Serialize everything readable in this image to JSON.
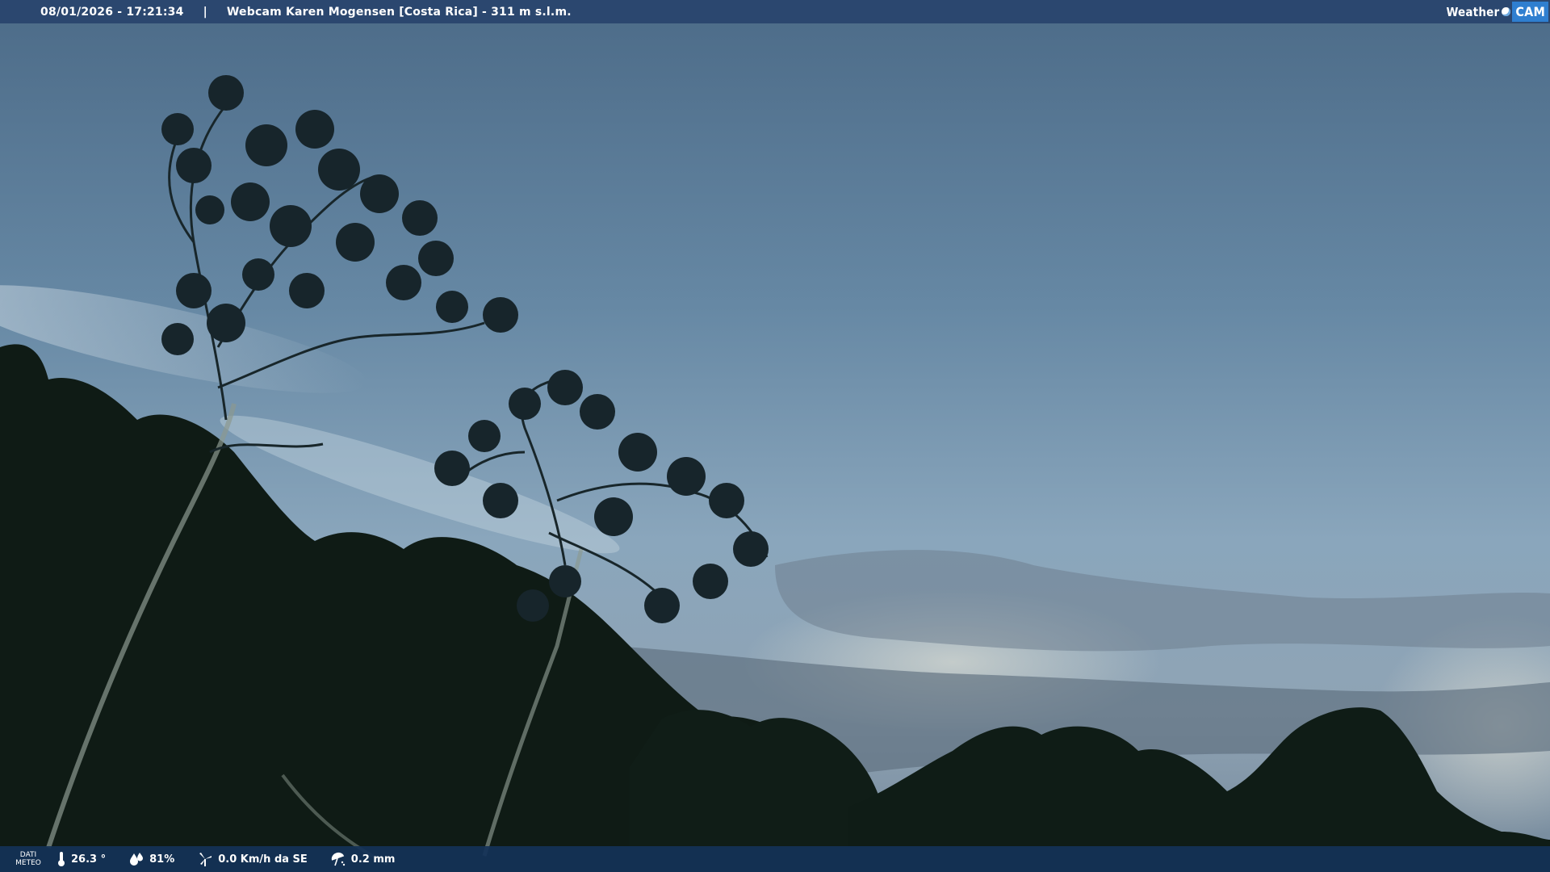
{
  "header": {
    "datetime": "08/01/2026 - 17:21:34",
    "separator": "|",
    "title": "Webcam Karen Mogensen [Costa Rica]  - 311 m s.l.m."
  },
  "logo": {
    "weather": "Weather",
    "cam": "CAM"
  },
  "footer": {
    "dati_line1": "DATI",
    "dati_line2": "METEO",
    "temperature": "26.3 °",
    "humidity": "81%",
    "wind": "0.0 Km/h da SE",
    "rain": "0.2 mm"
  },
  "colors": {
    "sky_top": "#4f6f8c",
    "sky_mid": "#7d9cb5",
    "sky_low": "#a9bfce",
    "foliage": "#0f1b14",
    "header_bar": "#28446c",
    "footer_bar": "#143258",
    "logo_accent": "#2f7fd0"
  }
}
